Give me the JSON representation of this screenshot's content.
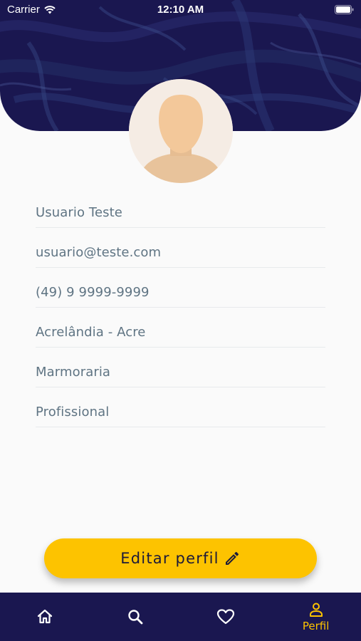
{
  "status_bar": {
    "carrier": "Carrier",
    "time": "12:10 AM"
  },
  "colors": {
    "header_bg": "#1a1750",
    "accent": "#fdc300",
    "field_text": "#5f7483",
    "tab_inactive": "#ffffff"
  },
  "profile": {
    "fields": [
      {
        "value": "Usuario Teste"
      },
      {
        "value": "usuario@teste.com"
      },
      {
        "value": "(49) 9 9999-9999"
      },
      {
        "value": "Acrelândia - Acre"
      },
      {
        "value": "Marmoraria"
      },
      {
        "value": "Profissional"
      }
    ]
  },
  "actions": {
    "edit_label": "Editar perfil",
    "edit_icon": "pencil-icon"
  },
  "tabbar": {
    "items": [
      {
        "icon": "home-icon",
        "label": "",
        "active": false
      },
      {
        "icon": "search-icon",
        "label": "",
        "active": false
      },
      {
        "icon": "heart-icon",
        "label": "",
        "active": false
      },
      {
        "icon": "user-icon",
        "label": "Perfil",
        "active": true
      }
    ]
  }
}
